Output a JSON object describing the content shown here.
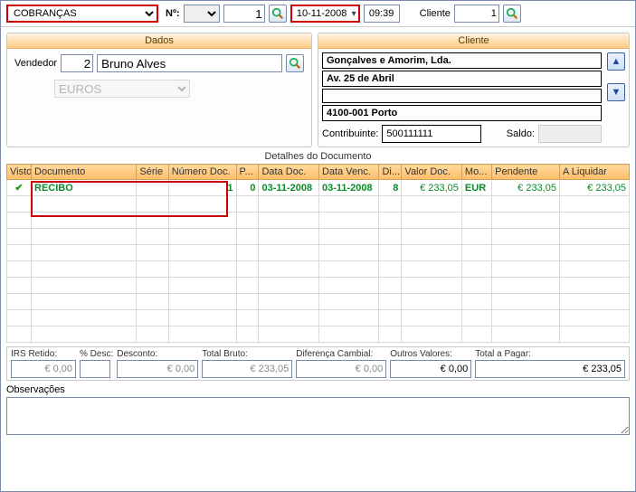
{
  "toolbar": {
    "doc_type": "COBRANÇAS",
    "n_label": "Nº:",
    "serie": "",
    "number": "1",
    "date": "10-11-2008",
    "time": "09:39",
    "cliente_label": "Cliente",
    "cliente_num": "1"
  },
  "dados": {
    "title": "Dados",
    "vendedor_label": "Vendedor",
    "vendedor_code": "2",
    "vendedor_name": "Bruno Alves",
    "currency": "EUROS"
  },
  "cliente": {
    "title": "Cliente",
    "name": "Gonçalves e Amorim, Lda.",
    "addr1": "Av. 25 de Abril",
    "addr2": "",
    "city": "4100-001 Porto",
    "contrib_label": "Contribuinte:",
    "contrib": "500111111",
    "saldo_label": "Saldo:",
    "saldo": ""
  },
  "details": {
    "title": "Detalhes do Documento",
    "headers": {
      "visto": "Visto",
      "documento": "Documento",
      "serie": "Série",
      "numero": "Número Doc.",
      "p": "P...",
      "datadoc": "Data Doc.",
      "datavenc": "Data Venc.",
      "di": "Di...",
      "valordoc": "Valor Doc.",
      "mo": "Mo...",
      "pendente": "Pendente",
      "aliquidar": "A Liquidar"
    },
    "row": {
      "documento": "RECIBO",
      "serie": "",
      "numero": "1",
      "p": "0",
      "datadoc": "03-11-2008",
      "datavenc": "03-11-2008",
      "di": "8",
      "valordoc": "€ 233,05",
      "mo": "EUR",
      "pendente": "€ 233,05",
      "aliquidar": "€ 233,05"
    }
  },
  "totals": {
    "irs_label": "IRS Retido:",
    "irs": "€ 0,00",
    "pdesc_label": "% Desc:",
    "pdesc": "",
    "desconto_label": "Desconto:",
    "desconto": "€ 0,00",
    "bruto_label": "Total Bruto:",
    "bruto": "€ 233,05",
    "difcamb_label": "Diferença Cambial:",
    "difcamb": "€ 0,00",
    "outros_label": "Outros Valores:",
    "outros": "€ 0,00",
    "total_label": "Total a Pagar:",
    "total": "€ 233,05"
  },
  "obs": {
    "label": "Observações",
    "text": ""
  }
}
